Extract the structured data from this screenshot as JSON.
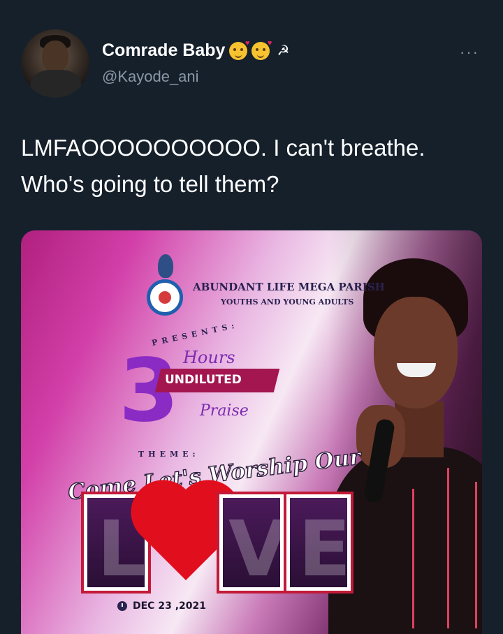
{
  "tweet": {
    "display_name": "Comrade Baby",
    "name_emojis": [
      "smiling-face-with-hearts",
      "smiling-face-with-hearts"
    ],
    "name_symbol": "☭",
    "handle": "@Kayode_ani",
    "more_label": "···",
    "text": "LMFAOOOOOOOOOO. I can't breathe. Who's going to tell them?"
  },
  "flyer": {
    "parish_name": "ABUNDANT LIFE MEGA PARISH",
    "parish_sub": "YOUTHS AND YOUNG ADULTS",
    "presents_label": "PRESENTS:",
    "big_number": "3",
    "hours_label": "Hours",
    "undiluted_label": "UNDILUTED",
    "praise_label": "Praise",
    "theme_label": "THEME:",
    "theme_script": "Come Let's Worship Our",
    "love_letters": [
      "L",
      "V",
      "E"
    ],
    "date": "DEC 23 ,2021"
  },
  "colors": {
    "background": "#15202b",
    "handle": "#8b98a5",
    "accent_purple": "#8a2bc4",
    "heart_red": "#e10e1e"
  }
}
